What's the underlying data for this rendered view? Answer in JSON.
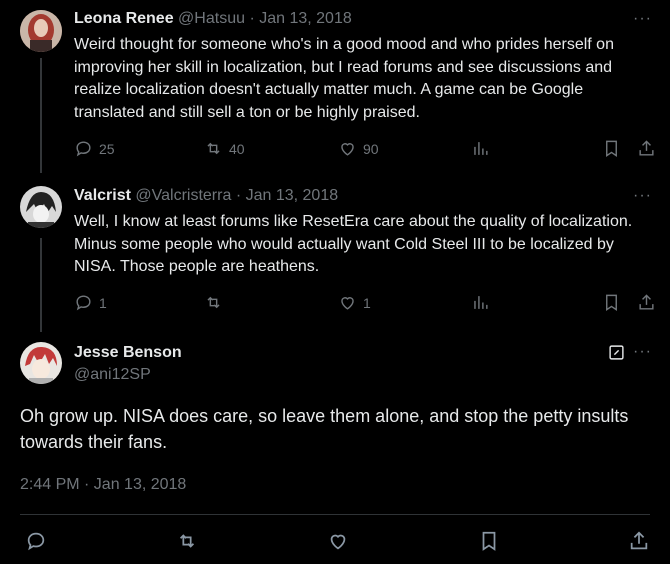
{
  "tweets": [
    {
      "name": "Leona Renee",
      "handle": "@Hatsuu",
      "date": "· Jan 13, 2018",
      "text": "Weird thought for someone who's in a good mood and who prides herself on improving her skill in localization, but I read forums and see discussions and realize localization doesn't actually matter much. A game can be Google translated and still sell a ton or be highly praised.",
      "replies": "25",
      "retweets": "40",
      "likes": "90"
    },
    {
      "name": "Valcrist",
      "handle": "@Valcristerra",
      "date": "· Jan 13, 2018",
      "text": "Well, I know at least forums like ResetEra care about the quality of localization. Minus some people who would actually want Cold Steel III to be localized by NISA. Those people are heathens.",
      "replies": "1",
      "retweets": "",
      "likes": "1"
    }
  ],
  "main_tweet": {
    "name": "Jesse Benson",
    "handle": "@ani12SP",
    "text": "Oh grow up. NISA does care, so leave them alone, and stop the petty insults towards their fans.",
    "timestamp": "2:44 PM · Jan 13, 2018"
  },
  "more_glyph": "···",
  "colors": {
    "background": "#000000",
    "text": "#e7e9ea",
    "muted": "#71767b",
    "divider": "#2f3336"
  },
  "icons": [
    "reply-icon",
    "retweet-icon",
    "like-icon",
    "views-icon",
    "bookmark-icon",
    "share-icon",
    "edit-icon",
    "more-icon"
  ]
}
